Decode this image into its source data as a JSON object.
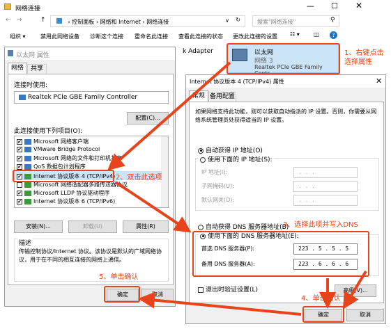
{
  "explorer": {
    "title": "网络连接",
    "address": [
      "控制面板",
      "网络和 Internet",
      "网络连接"
    ],
    "search_placeholder": "搜索\"网络连接\"",
    "toolbar": [
      "组织 ▾",
      "禁用此网络设备",
      "诊断这个连接",
      "重命名此连接",
      "查看此连接的状态",
      "更改此连接的设置"
    ],
    "adapter_left": "k Adapter",
    "adapter": {
      "name": "以太网",
      "network": "网络 3",
      "device": "Realtek PCIe GBE Family Contr..."
    }
  },
  "eth_props": {
    "title": "以太网 属性",
    "tabs": [
      "网络",
      "共享"
    ],
    "connect_using_label": "连接时使用:",
    "device": "Realtek PCIe GBE Family Controller",
    "configure": "配置(C)...",
    "items_label": "此连接使用下列项目(O):",
    "items": [
      {
        "label": "Microsoft 网络客户端",
        "checked": true
      },
      {
        "label": "VMware Bridge Protocol",
        "checked": true
      },
      {
        "label": "Microsoft 网络的文件和打印机共享",
        "checked": true
      },
      {
        "label": "QoS 数据包计划程序",
        "checked": true
      },
      {
        "label": "Internet 协议版本 4 (TCP/IPv4)",
        "checked": true
      },
      {
        "label": "Microsoft 网络适配器多路传送器协议",
        "checked": false
      },
      {
        "label": "Microsoft LLDP 协议驱动程序",
        "checked": true
      },
      {
        "label": "Internet 协议版本 6 (TCP/IPv6)",
        "checked": true
      }
    ],
    "install": "安装(N)...",
    "uninstall": "卸载(U)",
    "properties": "属性(R)",
    "desc_title": "描述",
    "desc": "传输控制协议/Internet 协议。该协议是默认的广域网络协议，用于在不同的相互连接的网络上通信。",
    "ok": "确定",
    "cancel": "取消"
  },
  "ipv4": {
    "title": "Internet 协议版本 4 (TCP/IPv4) 属性",
    "tabs": [
      "常规",
      "备用配置"
    ],
    "intro": "如果网络支持此功能，则可以获取自动指派的 IP 设置。否则，你需要从网络系统管理员处获得适当的 IP 设置。",
    "auto_ip": "自动获得 IP 地址(O)",
    "manual_ip": "使用下面的 IP 地址(S):",
    "ip_label": "IP 地址(I):",
    "mask_label": "子网掩码(U):",
    "gw_label": "默认网关(D):",
    "empty_ip": ".  .  .",
    "auto_dns": "自动获得 DNS 服务器地址(B)",
    "manual_dns": "使用下面的 DNS 服务器地址(E):",
    "pref_dns_label": "首选 DNS 服务器(P):",
    "pref_dns": "223 . 5 . 5 . 5",
    "alt_dns_label": "备用 DNS 服务器(A):",
    "alt_dns": "223 . 6 . 6 . 6",
    "validate": "退出时验证设置(L)",
    "advanced": "高级(V)...",
    "ok": "确定",
    "cancel": "取消"
  },
  "annotations": {
    "step1": "1、右键点击\n选择属性",
    "step2": "2、双击此选项",
    "step3": "3、选择此项并写入DNS",
    "step4": "4、单击确认",
    "step5": "5、单击确认"
  },
  "colors": {
    "accent": "#e8431a",
    "selection": "#cce4f7",
    "title_blue": "#0078d7"
  }
}
